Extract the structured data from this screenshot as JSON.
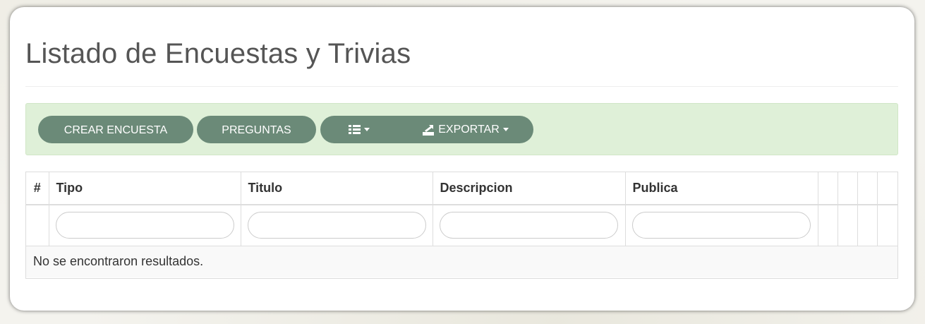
{
  "page": {
    "title": "Listado de Encuestas y Trivias"
  },
  "toolbar": {
    "crear_label": "CREAR ENCUESTA",
    "preguntas_label": "PREGUNTAS",
    "columns_icon": "list-icon",
    "export_label": "EXPORTAR",
    "export_icon": "export-icon"
  },
  "table": {
    "columns": [
      "#",
      "Tipo",
      "Titulo",
      "Descripcion",
      "Publica",
      "",
      "",
      "",
      ""
    ],
    "empty_message": "No se encontraron resultados.",
    "filters": {
      "tipo": "",
      "titulo": "",
      "descripcion": "",
      "publica": ""
    }
  },
  "colors": {
    "button": "#6b8a78",
    "toolbar_bg": "#dff0d8",
    "title": "#555555"
  }
}
